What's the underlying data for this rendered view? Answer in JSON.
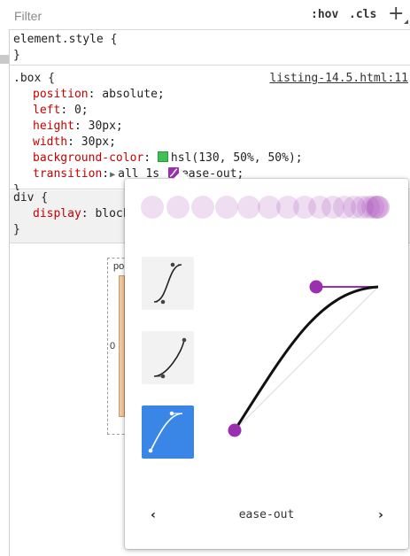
{
  "filter": {
    "placeholder": "Filter",
    "hov": ":hov",
    "cls": ".cls",
    "add": "+"
  },
  "element_style": {
    "selector": "element.style {",
    "close": "}"
  },
  "box_rule": {
    "selector": ".box {",
    "source": "listing-14.5.html:11",
    "props": [
      {
        "name": "position",
        "value": "absolute;"
      },
      {
        "name": "left",
        "value": "0;"
      },
      {
        "name": "height",
        "value": "30px;"
      },
      {
        "name": "width",
        "value": "30px;"
      },
      {
        "name": "background-color",
        "value": "hsl(130, 50%, 50%);",
        "swatch": "#40bf55"
      },
      {
        "name": "transition",
        "value_pre": "all 1s",
        "value_post": "ease-out;"
      }
    ],
    "close": "}"
  },
  "div_rule": {
    "selector": "div {",
    "props": [
      {
        "name": "display",
        "value": "block"
      }
    ],
    "close": "}"
  },
  "box_model": {
    "label": "po",
    "value": "0"
  },
  "bezier_popover": {
    "easing_name": "ease-out",
    "prev": "‹",
    "next": "›",
    "accent_color": "#9b2fb0",
    "selected_color": "#3a86e6",
    "presets": [
      "ease-in-out",
      "ease-in",
      "ease-out"
    ],
    "selected_preset": "ease-out"
  }
}
